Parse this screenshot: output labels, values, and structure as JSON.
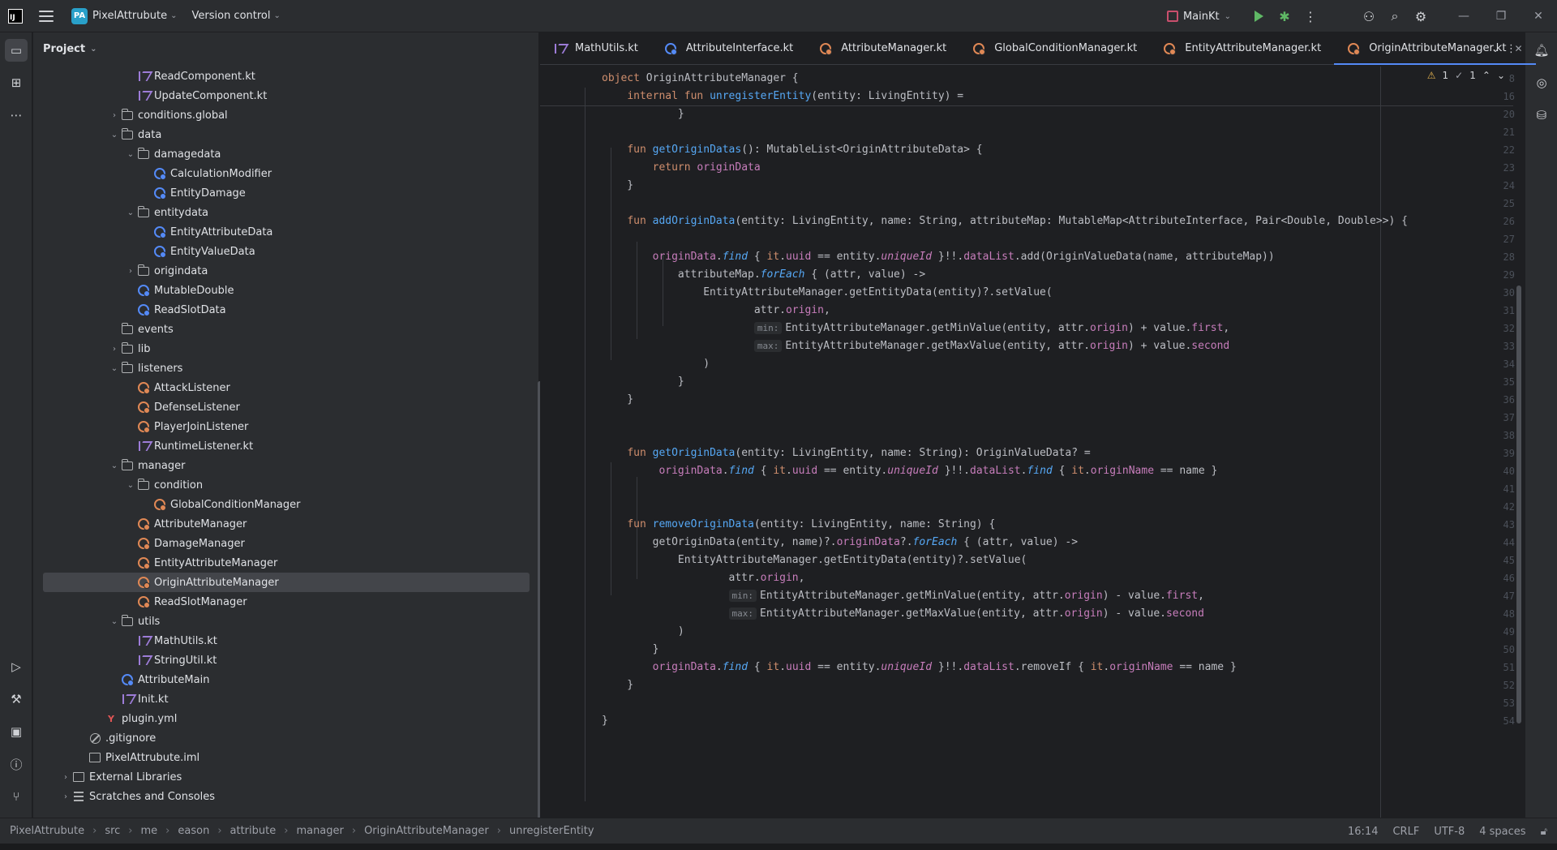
{
  "titlebar": {
    "app_logo": "IJ",
    "project_badge": "PA",
    "project_name": "PixelAttrubute",
    "vcs": "Version control",
    "run_config": "MainKt"
  },
  "project_panel": {
    "title": "Project",
    "tree": [
      {
        "label": "ReadComponent.kt",
        "icon": "kt",
        "depth": 3,
        "arrow": ""
      },
      {
        "label": "UpdateComponent.kt",
        "icon": "kt",
        "depth": 3,
        "arrow": ""
      },
      {
        "label": "conditions.global",
        "icon": "folder",
        "depth": 2,
        "arrow": "right"
      },
      {
        "label": "data",
        "icon": "folder",
        "depth": 2,
        "arrow": "down"
      },
      {
        "label": "damagedata",
        "icon": "folder",
        "depth": 3,
        "arrow": "down"
      },
      {
        "label": "CalculationModifier",
        "icon": "blue",
        "depth": 4,
        "arrow": ""
      },
      {
        "label": "EntityDamage",
        "icon": "blue",
        "depth": 4,
        "arrow": ""
      },
      {
        "label": "entitydata",
        "icon": "folder",
        "depth": 3,
        "arrow": "down"
      },
      {
        "label": "EntityAttributeData",
        "icon": "blue",
        "depth": 4,
        "arrow": ""
      },
      {
        "label": "EntityValueData",
        "icon": "blue",
        "depth": 4,
        "arrow": ""
      },
      {
        "label": "origindata",
        "icon": "folder",
        "depth": 3,
        "arrow": "right"
      },
      {
        "label": "MutableDouble",
        "icon": "blue",
        "depth": 3,
        "arrow": ""
      },
      {
        "label": "ReadSlotData",
        "icon": "blue",
        "depth": 3,
        "arrow": ""
      },
      {
        "label": "events",
        "icon": "folder",
        "depth": 2,
        "arrow": ""
      },
      {
        "label": "lib",
        "icon": "folder",
        "depth": 2,
        "arrow": "right"
      },
      {
        "label": "listeners",
        "icon": "folder",
        "depth": 2,
        "arrow": "down"
      },
      {
        "label": "AttackListener",
        "icon": "orange",
        "depth": 3,
        "arrow": ""
      },
      {
        "label": "DefenseListener",
        "icon": "orange",
        "depth": 3,
        "arrow": ""
      },
      {
        "label": "PlayerJoinListener",
        "icon": "orange",
        "depth": 3,
        "arrow": ""
      },
      {
        "label": "RuntimeListener.kt",
        "icon": "kt",
        "depth": 3,
        "arrow": ""
      },
      {
        "label": "manager",
        "icon": "folder",
        "depth": 2,
        "arrow": "down"
      },
      {
        "label": "condition",
        "icon": "folder",
        "depth": 3,
        "arrow": "down"
      },
      {
        "label": "GlobalConditionManager",
        "icon": "orange",
        "depth": 4,
        "arrow": ""
      },
      {
        "label": "AttributeManager",
        "icon": "orange",
        "depth": 3,
        "arrow": ""
      },
      {
        "label": "DamageManager",
        "icon": "orange",
        "depth": 3,
        "arrow": ""
      },
      {
        "label": "EntityAttributeManager",
        "icon": "orange",
        "depth": 3,
        "arrow": ""
      },
      {
        "label": "OriginAttributeManager",
        "icon": "orange",
        "depth": 3,
        "arrow": "",
        "selected": true
      },
      {
        "label": "ReadSlotManager",
        "icon": "orange",
        "depth": 3,
        "arrow": ""
      },
      {
        "label": "utils",
        "icon": "folder",
        "depth": 2,
        "arrow": "down"
      },
      {
        "label": "MathUtils.kt",
        "icon": "kt",
        "depth": 3,
        "arrow": ""
      },
      {
        "label": "StringUtil.kt",
        "icon": "kt",
        "depth": 3,
        "arrow": ""
      },
      {
        "label": "AttributeMain",
        "icon": "blue",
        "depth": 2,
        "arrow": ""
      },
      {
        "label": "Init.kt",
        "icon": "kt",
        "depth": 2,
        "arrow": ""
      },
      {
        "label": "plugin.yml",
        "icon": "yml",
        "depth": 1,
        "arrow": ""
      },
      {
        "label": ".gitignore",
        "icon": "noent",
        "depth": 0,
        "arrow": ""
      },
      {
        "label": "PixelAttrubute.iml",
        "icon": "lib",
        "depth": 0,
        "arrow": ""
      },
      {
        "label": "External Libraries",
        "icon": "extlib",
        "depth": -1,
        "arrow": "right"
      },
      {
        "label": "Scratches and Consoles",
        "icon": "scr",
        "depth": -1,
        "arrow": "right"
      }
    ]
  },
  "tabs": [
    {
      "label": "MathUtils.kt",
      "icon": "kt"
    },
    {
      "label": "AttributeInterface.kt",
      "icon": "blue"
    },
    {
      "label": "AttributeManager.kt",
      "icon": "orange"
    },
    {
      "label": "GlobalConditionManager.kt",
      "icon": "orange"
    },
    {
      "label": "EntityAttributeManager.kt",
      "icon": "orange"
    },
    {
      "label": "OriginAttributeManager.kt",
      "icon": "orange",
      "active": true
    }
  ],
  "editor": {
    "warnings": "1",
    "weak_warnings": "1",
    "lines": [
      {
        "n": "8",
        "html": "<span class='kw'>object</span> OriginAttributeManager {",
        "indent": 0,
        "sticky": true
      },
      {
        "n": "16",
        "html": "    <span class='kw'>internal fun</span> <span class='fn'>unregisterEntity</span>(entity: LivingEntity) =",
        "indent": 0,
        "sticky": true
      },
      {
        "n": "20",
        "html": "            }",
        "indent": 0
      },
      {
        "n": "21",
        "html": "",
        "indent": 0
      },
      {
        "n": "22",
        "html": "    <span class='kw'>fun</span> <span class='fn'>getOriginDatas</span>(): MutableList&lt;OriginAttributeData&gt; {",
        "indent": 0
      },
      {
        "n": "23",
        "html": "        <span class='kw'>return</span> <span class='prop'>originData</span>",
        "indent": 0
      },
      {
        "n": "24",
        "html": "    }",
        "indent": 0
      },
      {
        "n": "25",
        "html": "",
        "indent": 0
      },
      {
        "n": "26",
        "html": "    <span class='kw'>fun</span> <span class='fn'>addOriginData</span>(entity: LivingEntity, name: String, attributeMap: MutableMap&lt;AttributeInterface, Pair&lt;Double, Double&gt;&gt;) {",
        "indent": 0
      },
      {
        "n": "27",
        "html": "",
        "indent": 0
      },
      {
        "n": "28",
        "html": "        <span class='prop'>originData</span>.<span class='ext'>find</span> { <span class='kw'>it</span>.<span class='prop'>uuid</span> == entity.<span class='ital'>uniqueId</span> }!!.<span class='prop'>dataList</span>.add(OriginValueData(name, attributeMap))",
        "indent": 0
      },
      {
        "n": "29",
        "html": "            attributeMap.<span class='ext'>forEach</span> { (attr, value) -&gt;",
        "indent": 0
      },
      {
        "n": "30",
        "html": "                EntityAttributeManager.getEntityData(entity)?.setValue(",
        "indent": 0
      },
      {
        "n": "31",
        "html": "                        attr.<span class='prop'>origin</span>,",
        "indent": 0
      },
      {
        "n": "32",
        "html": "                        <span class='hint'>min:</span>EntityAttributeManager.getMinValue(entity, attr.<span class='prop'>origin</span>) + value.<span class='prop'>first</span>,",
        "indent": 0
      },
      {
        "n": "33",
        "html": "                        <span class='hint'>max:</span>EntityAttributeManager.getMaxValue(entity, attr.<span class='prop'>origin</span>) + value.<span class='prop'>second</span>",
        "indent": 0
      },
      {
        "n": "34",
        "html": "                )",
        "indent": 0
      },
      {
        "n": "35",
        "html": "            }",
        "indent": 0
      },
      {
        "n": "36",
        "html": "    }",
        "indent": 0
      },
      {
        "n": "37",
        "html": "",
        "indent": 0
      },
      {
        "n": "38",
        "html": "",
        "indent": 0
      },
      {
        "n": "39",
        "html": "    <span class='kw'>fun</span> <span class='fn'>getOriginData</span>(entity: LivingEntity, name: String): OriginValueData? =",
        "indent": 0
      },
      {
        "n": "40",
        "html": "         <span class='prop'>originData</span>.<span class='ext'>find</span> { <span class='kw'>it</span>.<span class='prop'>uuid</span> == entity.<span class='ital'>uniqueId</span> }!!.<span class='prop'>dataList</span>.<span class='ext'>find</span> { <span class='kw'>it</span>.<span class='prop'>originName</span> == name }",
        "indent": 0
      },
      {
        "n": "41",
        "html": "",
        "indent": 0
      },
      {
        "n": "42",
        "html": "",
        "indent": 0
      },
      {
        "n": "43",
        "html": "    <span class='kw'>fun</span> <span class='fn'>removeOriginData</span>(entity: LivingEntity, name: String) {",
        "indent": 0
      },
      {
        "n": "44",
        "html": "        getOriginData(entity, name)?.<span class='prop'>originData</span>?.<span class='ext'>forEach</span> { (attr, value) -&gt;",
        "indent": 0
      },
      {
        "n": "45",
        "html": "            EntityAttributeManager.getEntityData(entity)?.setValue(",
        "indent": 0
      },
      {
        "n": "46",
        "html": "                    attr.<span class='prop'>origin</span>,",
        "indent": 0
      },
      {
        "n": "47",
        "html": "                    <span class='hint'>min:</span>EntityAttributeManager.getMinValue(entity, attr.<span class='prop'>origin</span>) - value.<span class='prop'>first</span>,",
        "indent": 0
      },
      {
        "n": "48",
        "html": "                    <span class='hint'>max:</span>EntityAttributeManager.getMaxValue(entity, attr.<span class='prop'>origin</span>) - value.<span class='prop'>second</span>",
        "indent": 0
      },
      {
        "n": "49",
        "html": "            )",
        "indent": 0
      },
      {
        "n": "50",
        "html": "        }",
        "indent": 0
      },
      {
        "n": "51",
        "html": "        <span class='prop'>originData</span>.<span class='ext'>find</span> { <span class='kw'>it</span>.<span class='prop'>uuid</span> == entity.<span class='ital'>uniqueId</span> }!!.<span class='prop'>dataList</span>.removeIf { <span class='kw'>it</span>.<span class='prop'>originName</span> == name }",
        "indent": 0
      },
      {
        "n": "52",
        "html": "    }",
        "indent": 0
      },
      {
        "n": "53",
        "html": "",
        "indent": 0
      },
      {
        "n": "54",
        "html": "}",
        "indent": 0
      }
    ]
  },
  "statusbar": {
    "breadcrumb": [
      "PixelAttrubute",
      "src",
      "me",
      "eason",
      "attribute",
      "manager",
      "OriginAttributeManager",
      "unregisterEntity"
    ],
    "position": "16:14",
    "line_sep": "CRLF",
    "encoding": "UTF-8",
    "indent": "4 spaces"
  }
}
